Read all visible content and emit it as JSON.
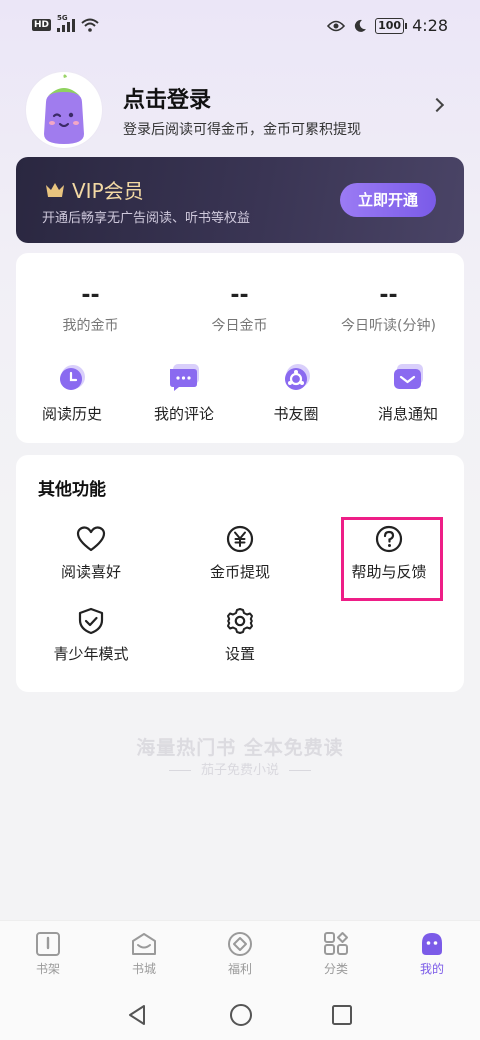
{
  "status_bar": {
    "badge": "HD",
    "network": "5G",
    "battery": "100",
    "time": "4:28"
  },
  "profile": {
    "title": "点击登录",
    "subtitle": "登录后阅读可得金币，金币可累积提现"
  },
  "vip": {
    "title": "VIP会员",
    "subtitle": "开通后畅享无广告阅读、听书等权益",
    "button": "立即开通"
  },
  "stats": [
    {
      "value": "--",
      "label": "我的金币"
    },
    {
      "value": "--",
      "label": "今日金币"
    },
    {
      "value": "--",
      "label": "今日听读(分钟)"
    }
  ],
  "quick_links": [
    {
      "label": "阅读历史",
      "icon": "history-icon"
    },
    {
      "label": "我的评论",
      "icon": "comment-icon"
    },
    {
      "label": "书友圈",
      "icon": "circle-icon"
    },
    {
      "label": "消息通知",
      "icon": "message-icon"
    }
  ],
  "other": {
    "title": "其他功能",
    "items": [
      {
        "label": "阅读喜好",
        "icon": "heart-icon"
      },
      {
        "label": "金币提现",
        "icon": "yen-icon"
      },
      {
        "label": "帮助与反馈",
        "icon": "help-icon"
      },
      {
        "label": "青少年模式",
        "icon": "shield-check-icon"
      },
      {
        "label": "设置",
        "icon": "gear-icon"
      }
    ]
  },
  "slogan": {
    "main": "海量热门书 全本免费读",
    "sub": "茄子免费小说"
  },
  "tabs": [
    {
      "label": "书架",
      "icon": "bookshelf-icon"
    },
    {
      "label": "书城",
      "icon": "bookstore-icon"
    },
    {
      "label": "福利",
      "icon": "welfare-icon"
    },
    {
      "label": "分类",
      "icon": "category-icon"
    },
    {
      "label": "我的",
      "icon": "profile-icon",
      "active": true
    }
  ],
  "colors": {
    "accent": "#7b5be8",
    "highlight": "#ee1e87",
    "vip_gold": "#f3d9a4"
  }
}
